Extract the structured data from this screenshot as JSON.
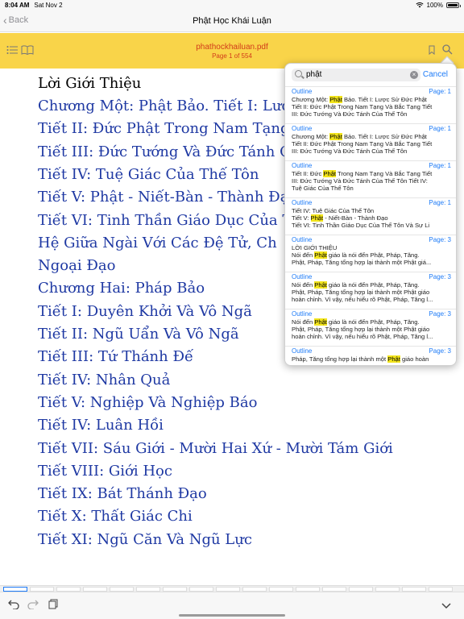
{
  "status_bar": {
    "time": "8:04 AM",
    "date": "Sat Nov 2",
    "battery": "100%",
    "battery_level": 1.0
  },
  "nav": {
    "back_label": "Back",
    "title": "Phật Học Khái Luận"
  },
  "pdf_toolbar": {
    "file_name": "phathockhailuan.pdf",
    "page_label": "Page 1 of 554",
    "bar_color": "#f9d449"
  },
  "document": {
    "heading": "Lời Giới Thiệu",
    "lines": [
      "Chương Một: Phật Bảo. Tiết I: Lược",
      "Tiết II: Đức Phật Trong Nam Tạng V",
      "Tiết III: Đức Tướng Và Đức Tánh Củ",
      "Tiết IV: Tuệ Giác Của Thế Tôn",
      "Tiết V: Phật - Niết-Bàn - Thành Đạo",
      "Tiết VI: Tinh Thần Giáo Dục Của T",
      "Hệ Giữa Ngài Với Các Đệ Tử, Ch",
      "Ngoại Đạo",
      "Chương Hai: Pháp Bảo",
      "Tiết I: Duyên Khởi Và Vô Ngã",
      "Tiết II: Ngũ Uẩn Và Vô Ngã",
      "Tiết III: Tứ Thánh Đế",
      "Tiết IV: Nhân Quả",
      "Tiết V: Nghiệp Và Nghiệp Báo",
      "Tiết IV: Luân Hồi",
      "Tiết VII: Sáu Giới - Mười Hai Xứ - Mười Tám Giới",
      "Tiết VIII: Giới Học",
      "Tiết IX: Bát Thánh Đạo",
      "Tiết X: Thất Giác Chi",
      "Tiết XI: Ngũ Căn Và Ngũ Lực"
    ]
  },
  "search": {
    "query": "phật",
    "cancel_label": "Cancel",
    "results": [
      {
        "source": "Outline",
        "page": "Page: 1",
        "lines": [
          {
            "pre": "Chương Một: ",
            "hit": "Phật",
            "post": " Bảo. Tiết I: Lược Sử Đức Phật"
          },
          {
            "pre": "Tiết II: Đức Phật Trong Nam Tạng Và Bắc Tạng Tiết",
            "hit": "",
            "post": ""
          },
          {
            "pre": "III: Đức Tướng Và Đức Tánh Của Thế Tôn",
            "hit": "",
            "post": ""
          }
        ]
      },
      {
        "source": "Outline",
        "page": "Page: 1",
        "lines": [
          {
            "pre": "Chương Một: ",
            "hit": "Phật",
            "post": " Bảo. Tiết I: Lược Sử Đức Phật"
          },
          {
            "pre": "Tiết II: Đức Phật Trong Nam Tạng Và Bắc Tạng Tiết",
            "hit": "",
            "post": ""
          },
          {
            "pre": "III: Đức Tướng Và Đức Tánh Của Thế Tôn",
            "hit": "",
            "post": ""
          }
        ]
      },
      {
        "source": "Outline",
        "page": "Page: 1",
        "lines": [
          {
            "pre": "Tiết II: Đức ",
            "hit": "Phật",
            "post": " Trong Nam Tạng Và Bắc Tạng Tiết"
          },
          {
            "pre": "III: Đức Tướng Và Đức Tánh Của Thế Tôn Tiết IV:",
            "hit": "",
            "post": ""
          },
          {
            "pre": "Tuệ Giác Của Thế Tôn",
            "hit": "",
            "post": ""
          }
        ]
      },
      {
        "source": "Outline",
        "page": "Page: 1",
        "lines": [
          {
            "pre": "Tiết IV: Tuệ Giác Của Thế Tôn",
            "hit": "",
            "post": ""
          },
          {
            "pre": "Tiết V: ",
            "hit": "Phật",
            "post": " - Niết-Bàn - Thành Đạo"
          },
          {
            "pre": "Tiết VI: Tinh Thần Giáo Dục Của Thế Tôn Và Sự Li",
            "hit": "",
            "post": ""
          }
        ]
      },
      {
        "source": "Outline",
        "page": "Page: 3",
        "lines": [
          {
            "pre": "LỜI GIỚI THIỆU",
            "hit": "",
            "post": ""
          },
          {
            "pre": "Nói đến ",
            "hit": "Phật",
            "post": " giáo là nói đến Phật, Pháp, Tăng."
          },
          {
            "pre": "Phật, Pháp, Tăng tổng hợp lại thành một Phật giá...",
            "hit": "",
            "post": ""
          }
        ]
      },
      {
        "source": "Outline",
        "page": "Page: 3",
        "lines": [
          {
            "pre": "Nói đến ",
            "hit": "Phật",
            "post": " giáo là nói đến Phật, Pháp, Tăng."
          },
          {
            "pre": "Phật, Pháp, Tăng tổng hợp lại thành một Phật giáo",
            "hit": "",
            "post": ""
          },
          {
            "pre": "hoàn chỉnh. Vì vậy, nếu hiểu rõ Phật, Pháp, Tăng l...",
            "hit": "",
            "post": ""
          }
        ]
      },
      {
        "source": "Outline",
        "page": "Page: 3",
        "lines": [
          {
            "pre": "Nói đến ",
            "hit": "Phật",
            "post": " giáo là nói đến Phật, Pháp, Tăng."
          },
          {
            "pre": "Phật, Pháp, Tăng tổng hợp lại thành một Phật giáo",
            "hit": "",
            "post": ""
          },
          {
            "pre": "hoàn chỉnh. Vì vậy, nếu hiểu rõ Phật, Pháp, Tăng l...",
            "hit": "",
            "post": ""
          }
        ]
      },
      {
        "source": "Outline",
        "page": "Page: 3",
        "lines": [
          {
            "pre": "Pháp, Tăng tổng hợp lại thành một ",
            "hit": "Phật",
            "post": " giáo hoàn"
          }
        ]
      }
    ]
  }
}
